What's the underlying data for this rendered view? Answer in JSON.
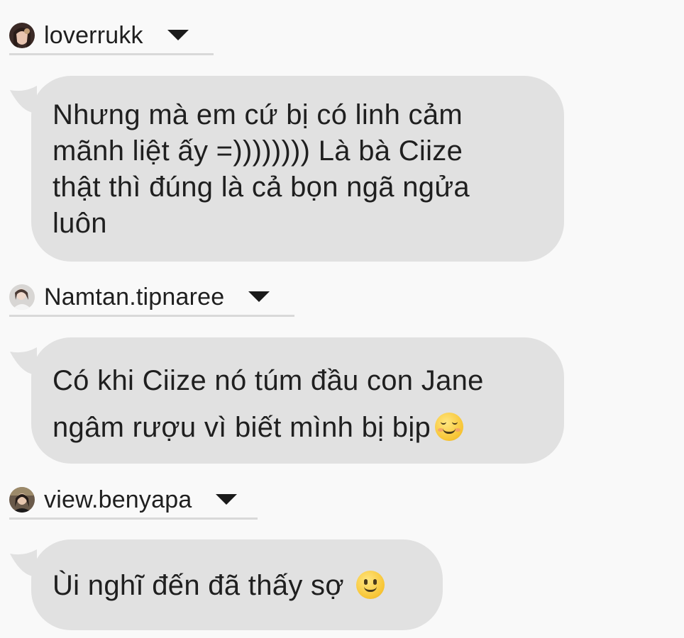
{
  "messages": [
    {
      "username": "loverrukk",
      "text_lines": [
        "Nhưng mà em cứ bị có linh cảm",
        "mãnh liệt ấy =)))))))) Là bà Ciize",
        "thật thì đúng là cả bọn ngã ngửa",
        "luôn"
      ]
    },
    {
      "username": "Namtan.tipnaree",
      "text_lines": [
        "Có khi Ciize nó túm đầu con Jane",
        "ngâm rượu vì biết mình bị bịp"
      ],
      "emoji": "relieved-face-emoji"
    },
    {
      "username": "view.benyapa",
      "text_lines": [
        "Ùi nghĩ đến đã thấy sợ"
      ],
      "emoji": "slightly-smiling-face-emoji"
    }
  ],
  "colors": {
    "background": "#f9f9f9",
    "bubble": "#e1e1e1",
    "text": "#1f1f1f",
    "divider": "#d9d9d9"
  }
}
